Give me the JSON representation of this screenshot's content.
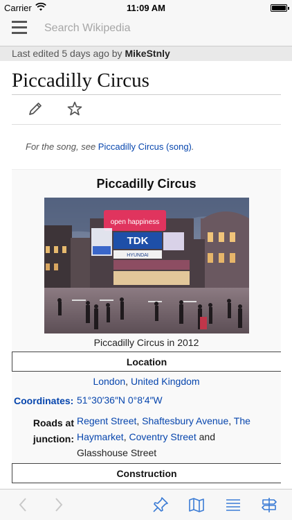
{
  "status_bar": {
    "carrier": "Carrier",
    "time": "11:09 AM"
  },
  "search": {
    "placeholder": "Search Wikipedia"
  },
  "last_edited": {
    "prefix": "Last edited 5 days ago by ",
    "user": "MikeStnly"
  },
  "article": {
    "title": "Piccadilly Circus",
    "hatnote_prefix": "For the song, see ",
    "hatnote_link": "Piccadilly Circus (song)",
    "hatnote_suffix": "."
  },
  "infobox": {
    "title": "Piccadilly Circus",
    "image_caption": "Piccadilly Circus in 2012",
    "location_header": "Location",
    "location_link_1": "London",
    "location_sep": ", ",
    "location_link_2": "United Kingdom",
    "coordinates_label": "Coordinates:",
    "coordinates_value": "51°30′36″N 0°8′4″W",
    "roads_label_1": "Roads at",
    "roads_label_2": "junction:",
    "roads": {
      "link_1": "Regent Street",
      "sep_1": ", ",
      "link_2": "Shaftesbury Avenue",
      "sep_2": ", ",
      "link_3": "The Haymarket",
      "sep_3": ", ",
      "link_4": "Coventry Street",
      "tail": " and Glasshouse Street"
    },
    "construction_header": "Construction"
  },
  "image_signs": {
    "sign_1": "open happiness",
    "sign_2": "TDK",
    "sign_3": "HYUNDAI"
  },
  "colors": {
    "link": "#0645ad",
    "toolbar_icon": "#3a7bd5",
    "toolbar_disabled": "#c8c8c8"
  }
}
